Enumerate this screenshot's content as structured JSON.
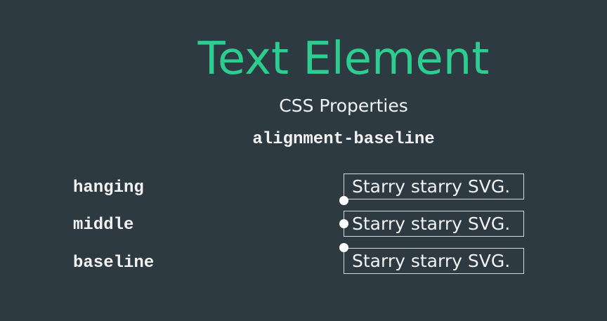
{
  "title": "Text Element",
  "subtitle": "CSS Properties",
  "property": "alignment-baseline",
  "rows": [
    {
      "label": "hanging",
      "sample": "Starry starry SVG."
    },
    {
      "label": "middle",
      "sample": "Starry starry SVG."
    },
    {
      "label": "baseline",
      "sample": "Starry starry SVG."
    }
  ],
  "colors": {
    "background": "#2d3a42",
    "title": "#2ecc8f",
    "text": "#f2f2f2",
    "box_border": "#d8d8d8",
    "anchor_dot": "#ffffff"
  }
}
